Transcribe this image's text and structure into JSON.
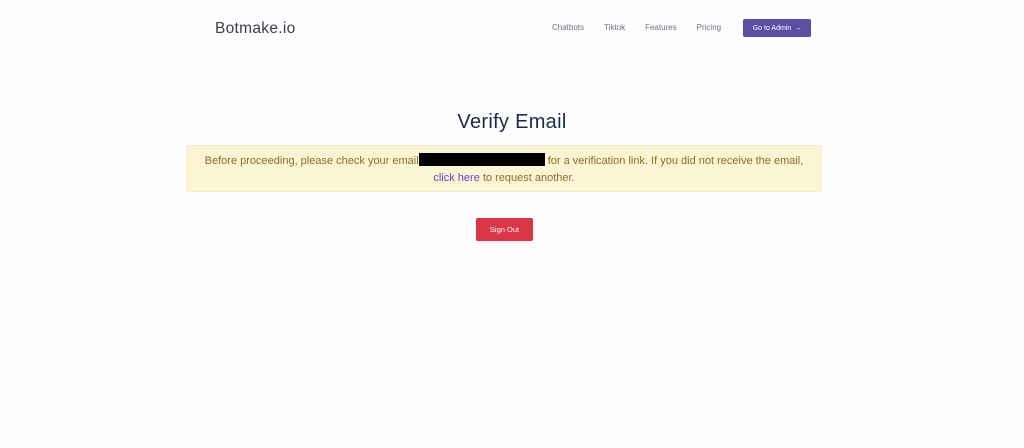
{
  "header": {
    "brand": "Botmake.io",
    "nav": [
      {
        "label": "Chatbots"
      },
      {
        "label": "Tiktok"
      },
      {
        "label": "Features"
      },
      {
        "label": "Pricing"
      }
    ],
    "admin_button": {
      "label": "Go to Admin",
      "icon": "arrow-right-icon"
    }
  },
  "main": {
    "title": "Verify Email",
    "alert": {
      "text_before": "Before proceeding, please check your email",
      "text_after": " for a verification link. If you did not receive the email, ",
      "link_text": "click here",
      "text_end": " to request another."
    },
    "signout_label": "Sign Out"
  },
  "colors": {
    "accent": "#5b4fa3",
    "danger": "#dc3545",
    "alert_bg": "#fcf5d4",
    "alert_text": "#8a6d2b",
    "link": "#6b3fc9",
    "title": "#1b2a4e"
  }
}
